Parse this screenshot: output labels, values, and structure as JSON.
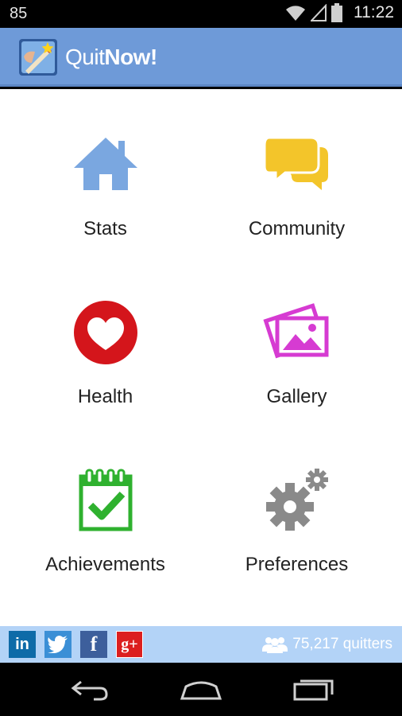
{
  "status_bar": {
    "left_text": "85",
    "time": "11:22",
    "icons": [
      "wifi-icon",
      "signal-icon",
      "battery-icon"
    ]
  },
  "app_bar": {
    "title_light": "Quit",
    "title_bold": "Now!",
    "logo": "quitnow-logo"
  },
  "menu": {
    "stats": {
      "label": "Stats",
      "icon": "house-icon",
      "color": "#7aa7e0"
    },
    "community": {
      "label": "Community",
      "icon": "chat-bubbles-icon",
      "color": "#f3c52a"
    },
    "health": {
      "label": "Health",
      "icon": "heart-icon",
      "color": "#d4151b"
    },
    "gallery": {
      "label": "Gallery",
      "icon": "photos-icon",
      "color": "#d63bd2"
    },
    "achievements": {
      "label": "Achievements",
      "icon": "calendar-check-icon",
      "color": "#2fb12f"
    },
    "preferences": {
      "label": "Preferences",
      "icon": "gears-icon",
      "color": "#8a8a8a"
    }
  },
  "footer": {
    "social": [
      {
        "icon": "linkedin-icon",
        "text": "in",
        "color": "#0e6ba8"
      },
      {
        "icon": "twitter-icon",
        "text": "",
        "color": "#3b8fd6"
      },
      {
        "icon": "facebook-icon",
        "text": "f",
        "color": "#3d5f9c"
      },
      {
        "icon": "google-plus-icon",
        "text": "g+",
        "color": "#dc1f1f"
      }
    ],
    "quitters_count": "75,217 quitters"
  },
  "nav_bar": {
    "buttons": [
      "back-icon",
      "home-icon",
      "recent-apps-icon"
    ]
  }
}
